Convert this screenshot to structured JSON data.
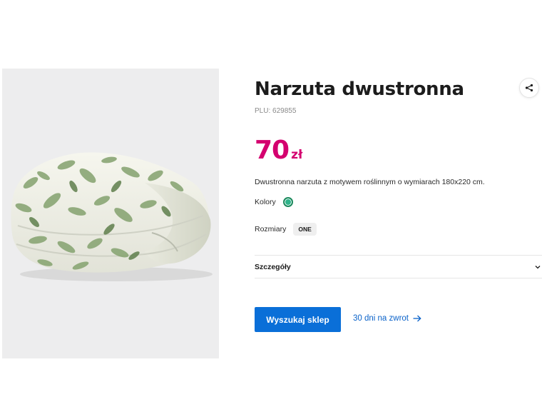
{
  "product": {
    "title": "Narzuta dwustronna",
    "plu": "PLU: 629855",
    "price_amount": "70",
    "price_currency": "zł",
    "description": "Dwustronna narzuta z motywem roślinnym o wymiarach 180x220 cm.",
    "image_alt": "Narzuta dwustronna"
  },
  "colors": {
    "label": "Kolory",
    "options": [
      {
        "name": "green",
        "hex": "#2fb38a"
      }
    ]
  },
  "sizes": {
    "label": "Rozmiary",
    "options": [
      "ONE"
    ]
  },
  "details": {
    "label": "Szczegóły"
  },
  "actions": {
    "store_button": "Wyszukaj sklep",
    "returns_link": "30 dni na zwrot"
  },
  "theme": {
    "price_color": "#d4006f",
    "primary_button": "#0a6fd8",
    "link_color": "#0a62c9",
    "gallery_bg": "#ededee"
  },
  "icons": [
    "share-icon",
    "chevron-down-icon",
    "arrow-right-icon"
  ]
}
